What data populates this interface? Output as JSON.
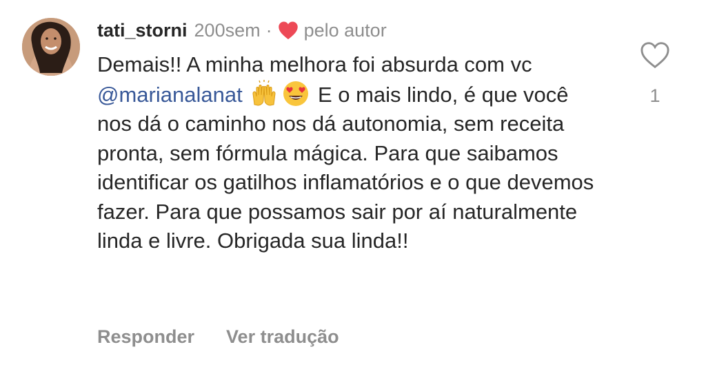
{
  "comment": {
    "username": "tati_storni",
    "time_ago": "200sem",
    "separator": "·",
    "liked_by_author": "pelo autor",
    "text": {
      "part1": "Demais!! A minha melhora foi absurda com vc ",
      "mention": "@marianalanat",
      "part2": " E o mais lindo, é que você nos dá o caminho nos dá autonomia, sem receita pronta, sem fórmula mágica. Para que saibamos identificar os gatilhos inflamatórios e o que devemos fazer. Para que possamos sair por aí naturalmente linda e livre. Obrigada sua linda!!"
    },
    "emojis": [
      "raising-hands",
      "heart-eyes"
    ],
    "like_count": "1",
    "actions": {
      "reply": "Responder",
      "translate": "Ver tradução"
    }
  },
  "colors": {
    "heart_red": "#ed4956",
    "mention": "#385898",
    "muted": "#8e8e8e",
    "text": "#262626"
  }
}
